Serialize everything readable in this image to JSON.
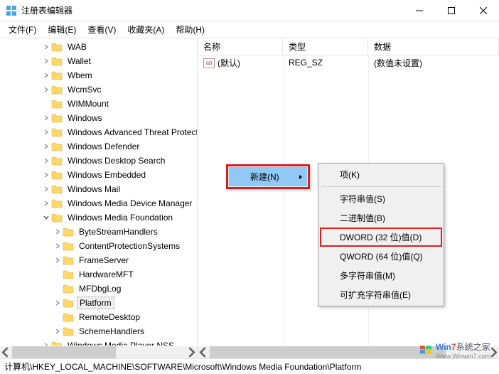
{
  "window": {
    "title": "注册表编辑器"
  },
  "menubar": [
    "文件(F)",
    "编辑(E)",
    "查看(V)",
    "收藏夹(A)",
    "帮助(H)"
  ],
  "tree": {
    "items": [
      {
        "label": "WAB",
        "indent": 2,
        "exp": "closed"
      },
      {
        "label": "Wallet",
        "indent": 2,
        "exp": "closed"
      },
      {
        "label": "Wbem",
        "indent": 2,
        "exp": "closed"
      },
      {
        "label": "WcmSvc",
        "indent": 2,
        "exp": "closed"
      },
      {
        "label": "WIMMount",
        "indent": 2,
        "exp": "none"
      },
      {
        "label": "Windows",
        "indent": 2,
        "exp": "closed"
      },
      {
        "label": "Windows Advanced Threat Protection",
        "indent": 2,
        "exp": "closed"
      },
      {
        "label": "Windows Defender",
        "indent": 2,
        "exp": "closed"
      },
      {
        "label": "Windows Desktop Search",
        "indent": 2,
        "exp": "closed"
      },
      {
        "label": "Windows Embedded",
        "indent": 2,
        "exp": "closed"
      },
      {
        "label": "Windows Mail",
        "indent": 2,
        "exp": "closed"
      },
      {
        "label": "Windows Media Device Manager",
        "indent": 2,
        "exp": "closed"
      },
      {
        "label": "Windows Media Foundation",
        "indent": 2,
        "exp": "open"
      },
      {
        "label": "ByteStreamHandlers",
        "indent": 3,
        "exp": "closed"
      },
      {
        "label": "ContentProtectionSystems",
        "indent": 3,
        "exp": "closed"
      },
      {
        "label": "FrameServer",
        "indent": 3,
        "exp": "closed"
      },
      {
        "label": "HardwareMFT",
        "indent": 3,
        "exp": "none"
      },
      {
        "label": "MFDbgLog",
        "indent": 3,
        "exp": "none"
      },
      {
        "label": "Platform",
        "indent": 3,
        "exp": "closed",
        "selected": true
      },
      {
        "label": "RemoteDesktop",
        "indent": 3,
        "exp": "none"
      },
      {
        "label": "SchemeHandlers",
        "indent": 3,
        "exp": "closed"
      },
      {
        "label": "Windows Media Player NSS",
        "indent": 2,
        "exp": "closed"
      }
    ]
  },
  "list": {
    "headers": {
      "name": "名称",
      "type": "类型",
      "data": "数据"
    },
    "rows": [
      {
        "name": "(默认)",
        "type": "REG_SZ",
        "data": "(数值未设置)"
      }
    ]
  },
  "context": {
    "primary": {
      "label": "新建(N)"
    },
    "secondary": [
      {
        "label": "项(K)",
        "type": "item"
      },
      {
        "type": "sep"
      },
      {
        "label": "字符串值(S)",
        "type": "item"
      },
      {
        "label": "二进制值(B)",
        "type": "item"
      },
      {
        "label": "DWORD (32 位)值(D)",
        "type": "item",
        "boxed": true
      },
      {
        "label": "QWORD (64 位)值(Q)",
        "type": "item"
      },
      {
        "label": "多字符串值(M)",
        "type": "item"
      },
      {
        "label": "可扩充字符串值(E)",
        "type": "item"
      }
    ]
  },
  "statusbar": "计算机\\HKEY_LOCAL_MACHINE\\SOFTWARE\\Microsoft\\Windows Media Foundation\\Platform",
  "watermark": {
    "brand1": "Win",
    "brand2": "7",
    "text": "系统之家",
    "url": "Www.Winwin7.com"
  }
}
